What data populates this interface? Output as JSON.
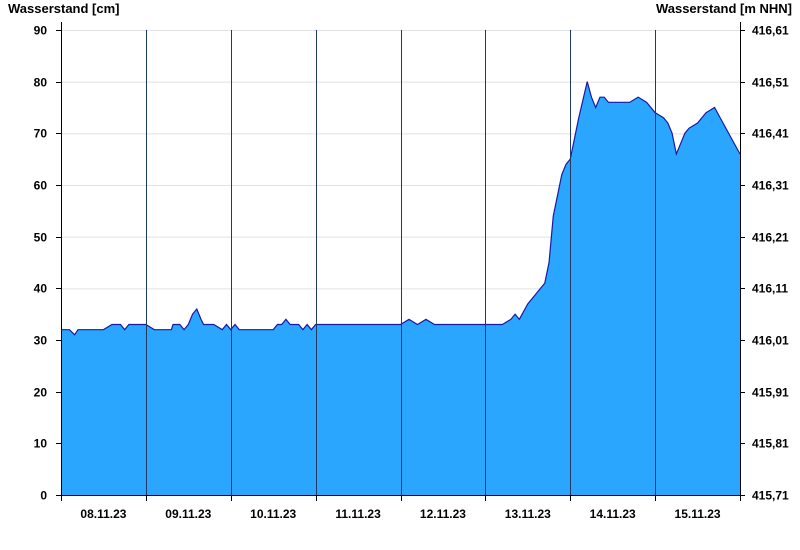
{
  "chart_data": {
    "type": "area",
    "ylabel_left": "Wasserstand [cm]",
    "ylabel_right": "Wasserstand [m NHN]",
    "ylim": [
      0,
      90
    ],
    "yticks": [
      0,
      10,
      20,
      30,
      40,
      50,
      60,
      70,
      80,
      90
    ],
    "yticks_right": [
      "415,71",
      "415,81",
      "415,91",
      "416,01",
      "416,11",
      "416,21",
      "416,31",
      "416,41",
      "416,51",
      "416,61"
    ],
    "x_tick_labels": [
      "08.11.23",
      "09.11.23",
      "10.11.23",
      "11.11.23",
      "12.11.23",
      "13.11.23",
      "14.11.23",
      "15.11.23"
    ],
    "x_range_days": [
      0,
      8
    ],
    "grid": true,
    "fill_color": "#2aa6ff",
    "line_color": "#1a1aa0",
    "series": [
      {
        "x_days": [
          0,
          0.1,
          0.16,
          0.2,
          0.3,
          0.5,
          0.6,
          0.7,
          0.75,
          0.8,
          0.9,
          1.0,
          1.1,
          1.2,
          1.3,
          1.32,
          1.4,
          1.45,
          1.5,
          1.55,
          1.6,
          1.65,
          1.68,
          1.7,
          1.75,
          1.8,
          1.9,
          1.95,
          2.0,
          2.05,
          2.1,
          2.2,
          2.3,
          2.4,
          2.5,
          2.55,
          2.6,
          2.65,
          2.7,
          2.75,
          2.8,
          2.85,
          2.9,
          2.95,
          3.0,
          3.2,
          3.4,
          3.6,
          3.8,
          4.0,
          4.1,
          4.2,
          4.3,
          4.4,
          4.5,
          4.7,
          4.9,
          5.0,
          5.1,
          5.2,
          5.3,
          5.35,
          5.4,
          5.5,
          5.6,
          5.7,
          5.75,
          5.8,
          5.85,
          5.9,
          5.95,
          6.0,
          6.1,
          6.2,
          6.25,
          6.3,
          6.35,
          6.4,
          6.45,
          6.5,
          6.6,
          6.7,
          6.8,
          6.9,
          7.0,
          7.1,
          7.15,
          7.2,
          7.25,
          7.3,
          7.35,
          7.4,
          7.5,
          7.6,
          7.7,
          7.8,
          7.9,
          8.0
        ],
        "values": [
          32,
          32,
          31,
          32,
          32,
          32,
          33,
          33,
          32,
          33,
          33,
          33,
          32,
          32,
          32,
          33,
          33,
          32,
          33,
          35,
          36,
          34,
          33,
          33,
          33,
          33,
          32,
          33,
          32,
          33,
          32,
          32,
          32,
          32,
          32,
          33,
          33,
          34,
          33,
          33,
          33,
          32,
          33,
          32,
          33,
          33,
          33,
          33,
          33,
          33,
          34,
          33,
          34,
          33,
          33,
          33,
          33,
          33,
          33,
          33,
          34,
          35,
          34,
          37,
          39,
          41,
          45,
          54,
          58,
          62,
          64,
          65,
          73,
          80,
          77,
          75,
          77,
          77,
          76,
          76,
          76,
          76,
          77,
          76,
          74,
          73,
          72,
          70,
          66,
          68,
          70,
          71,
          72,
          74,
          75,
          72,
          69,
          66
        ]
      }
    ]
  }
}
